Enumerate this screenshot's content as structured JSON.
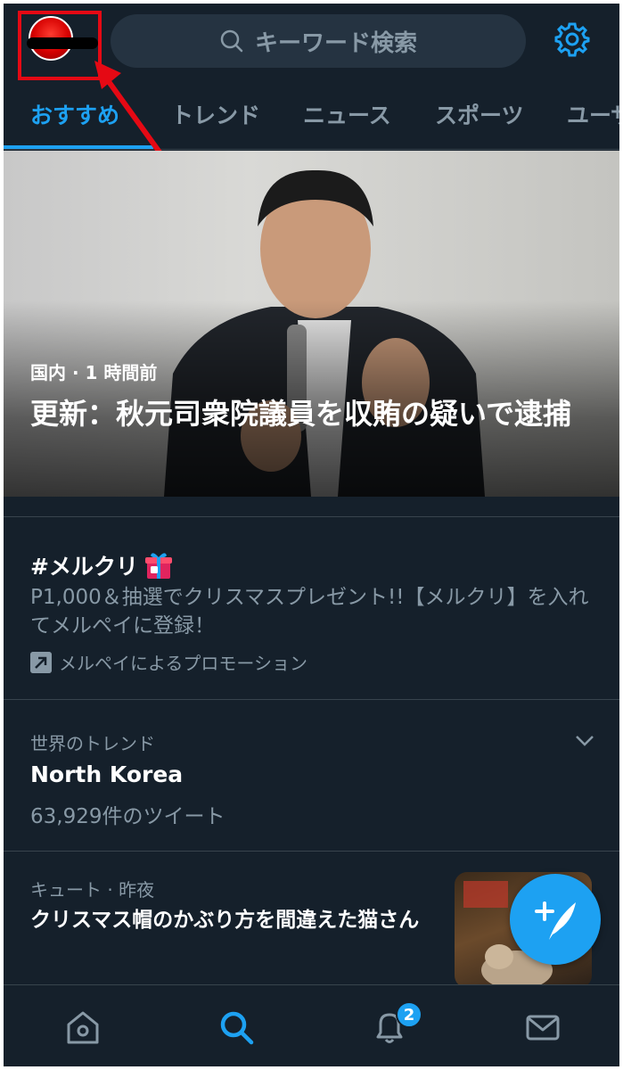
{
  "header": {
    "search_placeholder": "キーワード検索"
  },
  "tabs": [
    {
      "label": "おすすめ"
    },
    {
      "label": "トレンド"
    },
    {
      "label": "ニュース"
    },
    {
      "label": "スポーツ"
    },
    {
      "label": "ユーザー"
    }
  ],
  "hero": {
    "meta": "国内 · 1 時間前",
    "title": "更新：秋元司衆院議員を収賄の疑いで逮捕"
  },
  "promo": {
    "tag": "#メルクリ",
    "description": "P1,000＆抽選でクリスマスプレゼント!!【メルクリ】を入れてメルペイに登録！",
    "promoted_by": "メルペイによるプロモーション"
  },
  "trend": {
    "category": "世界のトレンド",
    "title": "North Korea",
    "count": "63,929件のツイート"
  },
  "story": {
    "meta": "キュート · 昨夜",
    "title": "クリスマス帽のかぶり方を間違えた猫さん"
  },
  "bottom_nav": {
    "notification_badge": "2"
  },
  "colors": {
    "background": "#15202b",
    "accent": "#1da1f2",
    "secondary_text": "#8899a6",
    "annotation": "#e50914"
  }
}
